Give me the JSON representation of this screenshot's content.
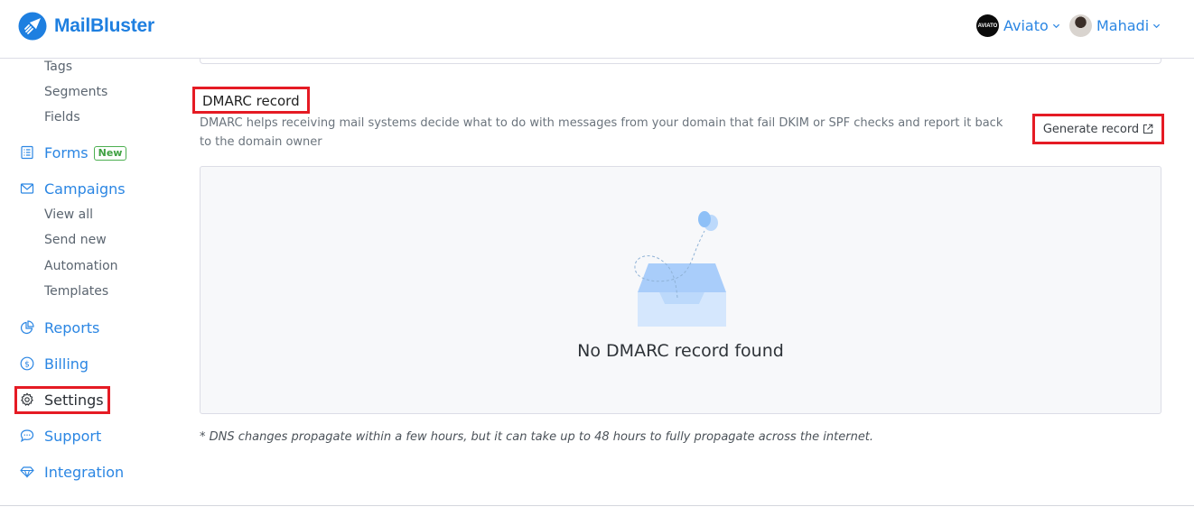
{
  "app": {
    "brand": "MailBluster",
    "brand_color": "#1e7fe0",
    "accent_color": "#2b86e3",
    "highlight_color": "#e51b24"
  },
  "header": {
    "accounts": [
      {
        "label": "Aviato",
        "avatar_text": "AVIATO",
        "icon": "chevron-down-icon"
      },
      {
        "label": "Mahadi",
        "icon": "chevron-down-icon"
      }
    ]
  },
  "sidebar": {
    "contacts_subitems": [
      "Tags",
      "Segments",
      "Fields"
    ],
    "forms": {
      "label": "Forms",
      "badge": "New",
      "icon": "form-list-icon"
    },
    "campaigns": {
      "label": "Campaigns",
      "icon": "envelope-icon"
    },
    "campaigns_subitems": [
      "View all",
      "Send new",
      "Automation",
      "Templates"
    ],
    "reports": {
      "label": "Reports",
      "icon": "pie-chart-icon"
    },
    "billing": {
      "label": "Billing",
      "icon": "dollar-circle-icon"
    },
    "settings": {
      "label": "Settings",
      "icon": "gear-icon"
    },
    "support": {
      "label": "Support",
      "icon": "chat-bubble-icon"
    },
    "integration": {
      "label": "Integration",
      "icon": "diamond-icon"
    }
  },
  "main": {
    "dmarc": {
      "title": "DMARC record",
      "description": "DMARC helps receiving mail systems decide what to do with messages from your domain that fail DKIM or SPF checks and report it back to the domain owner",
      "generate_button": "Generate record",
      "empty_state": "No DMARC record found"
    },
    "note": "* DNS changes propagate within a few hours, but it can take up to 48 hours to fully propagate across the internet."
  }
}
